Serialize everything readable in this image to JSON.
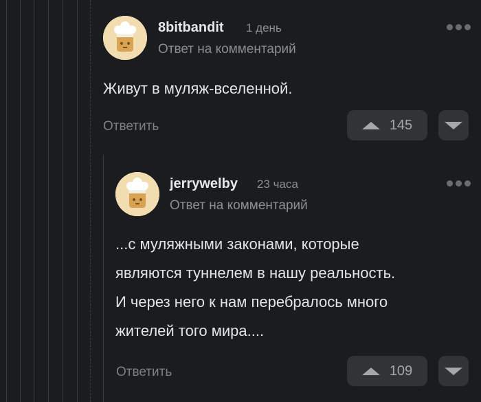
{
  "colors": {
    "background": "#1b1c1f",
    "button_bg": "#323337",
    "muted_text": "#8d8e92"
  },
  "comments": [
    {
      "username": "8bitbandit",
      "time": "1 день",
      "reply_to": "Ответ на комментарий",
      "text": "Живут в муляж-вселенной.",
      "reply_label": "Ответить",
      "rating": "145"
    },
    {
      "username": "jerrywelby",
      "time": "23 часа",
      "reply_to": "Ответ на комментарий",
      "text_lines": [
        "...с муляжными законами, которые",
        "являются туннелем в нашу реальность.",
        "И через него к нам перебралось много",
        "жителей того мира...."
      ],
      "reply_label": "Ответить",
      "rating": "109"
    }
  ]
}
